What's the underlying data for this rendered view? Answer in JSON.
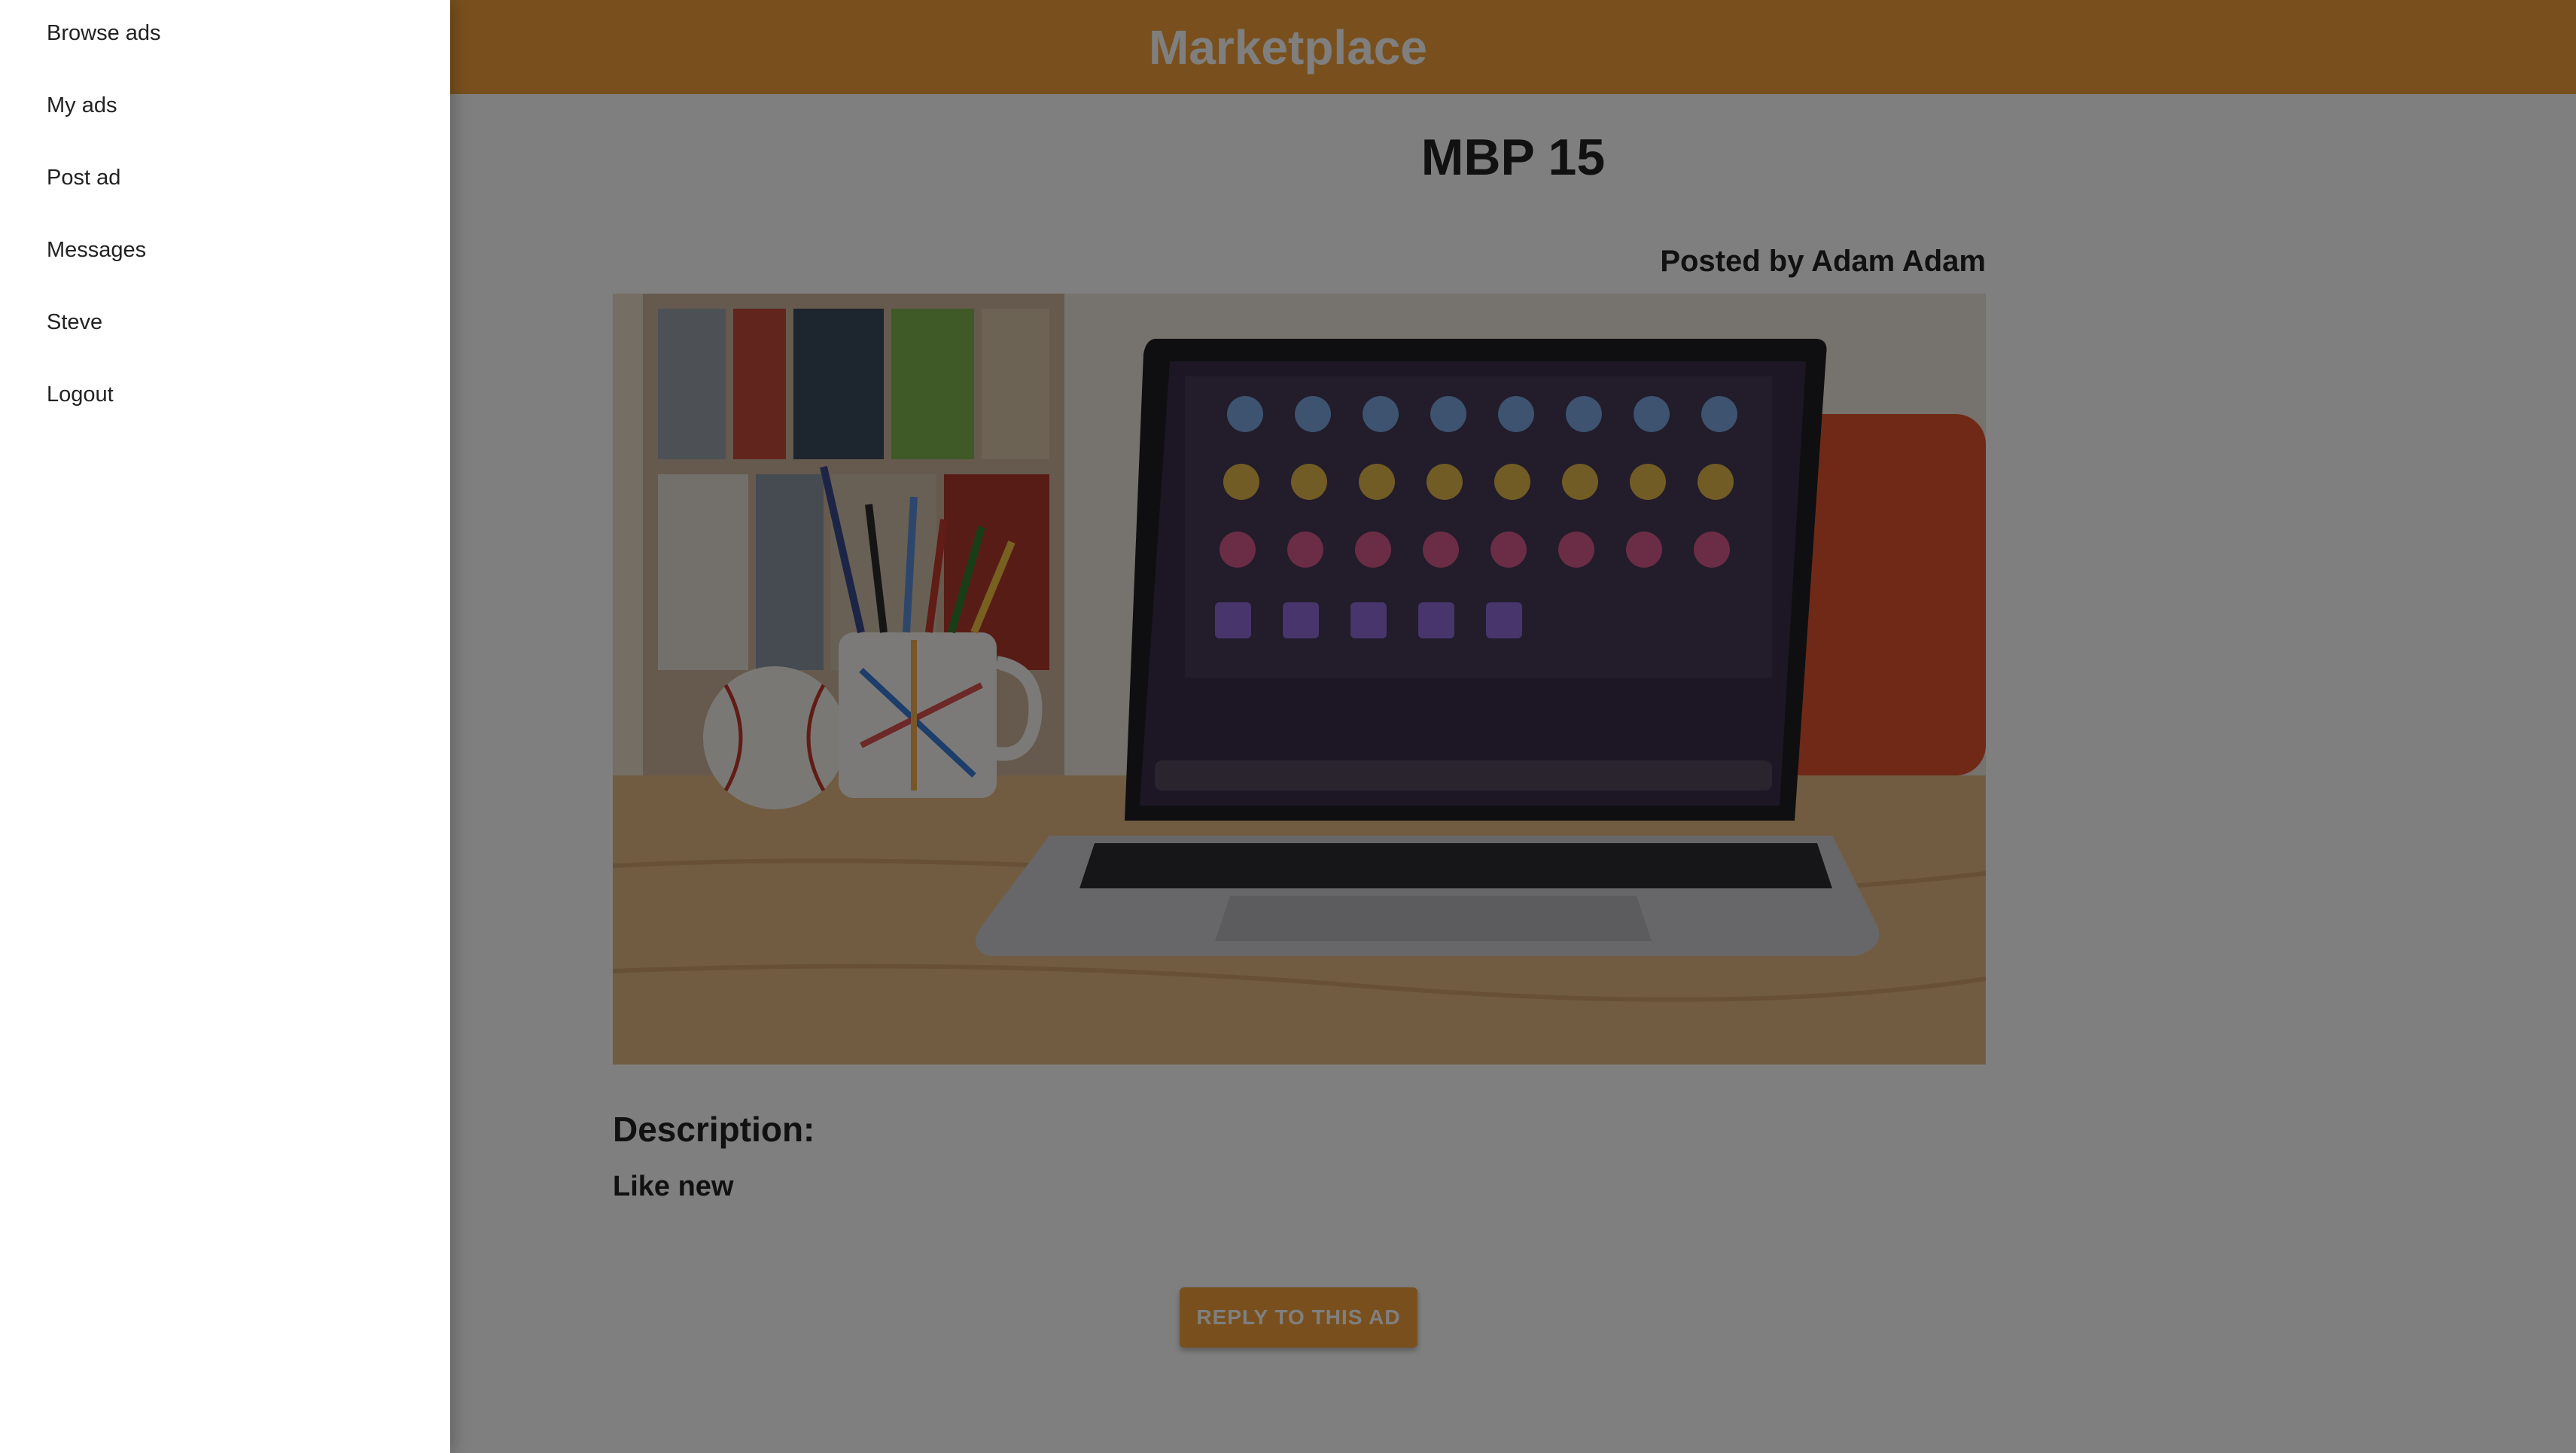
{
  "app": {
    "title": "Marketplace"
  },
  "drawer": {
    "items": [
      {
        "label": "Browse ads"
      },
      {
        "label": "My ads"
      },
      {
        "label": "Post ad"
      },
      {
        "label": "Messages"
      },
      {
        "label": "Steve"
      },
      {
        "label": "Logout"
      }
    ]
  },
  "ad": {
    "title": "MBP 15",
    "posted_by": "Posted by Adam Adam",
    "description_heading": "Description:",
    "description": "Like new",
    "reply_label": "REPLY TO THIS AD"
  },
  "colors": {
    "accent": "#f2a13a",
    "overlay": "rgba(0,0,0,0.5)"
  },
  "icons": {
    "ad_image": "laptop-photo"
  }
}
